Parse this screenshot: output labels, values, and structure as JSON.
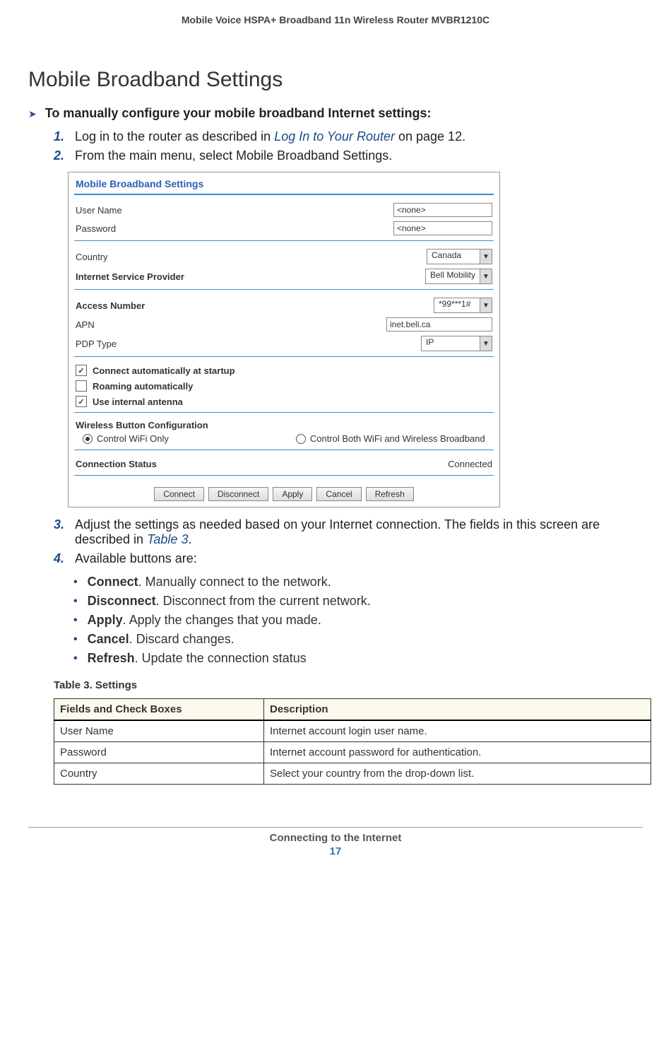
{
  "header": "Mobile Voice HSPA+ Broadband 11n Wireless Router MVBR1210C",
  "heading": "Mobile Broadband Settings",
  "task": "To manually configure your mobile broadband Internet settings:",
  "steps": {
    "s1_a": "Log in to the router as described in ",
    "s1_link": "Log In to Your Router",
    "s1_b": " on page 12.",
    "s2": "From the main menu, select Mobile Broadband Settings.",
    "s3_a": "Adjust the settings as needed based on your Internet connection. The fields in this screen are described in ",
    "s3_link": "Table 3",
    "s3_b": ".",
    "s4": "Available buttons are:"
  },
  "panel": {
    "title": "Mobile Broadband Settings",
    "user_name_label": "User Name",
    "user_name_value": "<none>",
    "password_label": "Password",
    "password_value": "<none>",
    "country_label": "Country",
    "country_value": "Canada",
    "isp_label": "Internet Service Provider",
    "isp_value": "Bell Mobility",
    "access_label": "Access Number",
    "access_value": "*99***1#",
    "apn_label": "APN",
    "apn_value": "inet.bell.ca",
    "pdp_label": "PDP Type",
    "pdp_value": "IP",
    "chk_startup": "Connect automatically at startup",
    "chk_roaming": "Roaming automatically",
    "chk_antenna": "Use internal antenna",
    "wireless_btn_cfg": "Wireless Button Configuration",
    "radio_wifi_only": "Control WiFi Only",
    "radio_both": "Control Both WiFi and Wireless Broadband",
    "conn_status_label": "Connection Status",
    "conn_status_value": "Connected",
    "buttons": {
      "connect": "Connect",
      "disconnect": "Disconnect",
      "apply": "Apply",
      "cancel": "Cancel",
      "refresh": "Refresh"
    }
  },
  "bullets": {
    "connect_b": "Connect",
    "connect_t": ". Manually connect to the network.",
    "disconnect_b": "Disconnect",
    "disconnect_t": ". Disconnect from the current network.",
    "apply_b": "Apply",
    "apply_t": ". Apply the changes that you made.",
    "cancel_b": "Cancel",
    "cancel_t": ". Discard changes.",
    "refresh_b": "Refresh",
    "refresh_t": ". Update the connection status"
  },
  "table": {
    "caption": "Table 3.  Settings",
    "h1": "Fields and Check Boxes",
    "h2": "Description",
    "r1c1": "User Name",
    "r1c2": "Internet account login user name.",
    "r2c1": "Password",
    "r2c2": "Internet account password for authentication.",
    "r3c1": "Country",
    "r3c2": "Select your country from the drop-down list."
  },
  "footer": {
    "section": "Connecting to the Internet",
    "page": "17"
  }
}
